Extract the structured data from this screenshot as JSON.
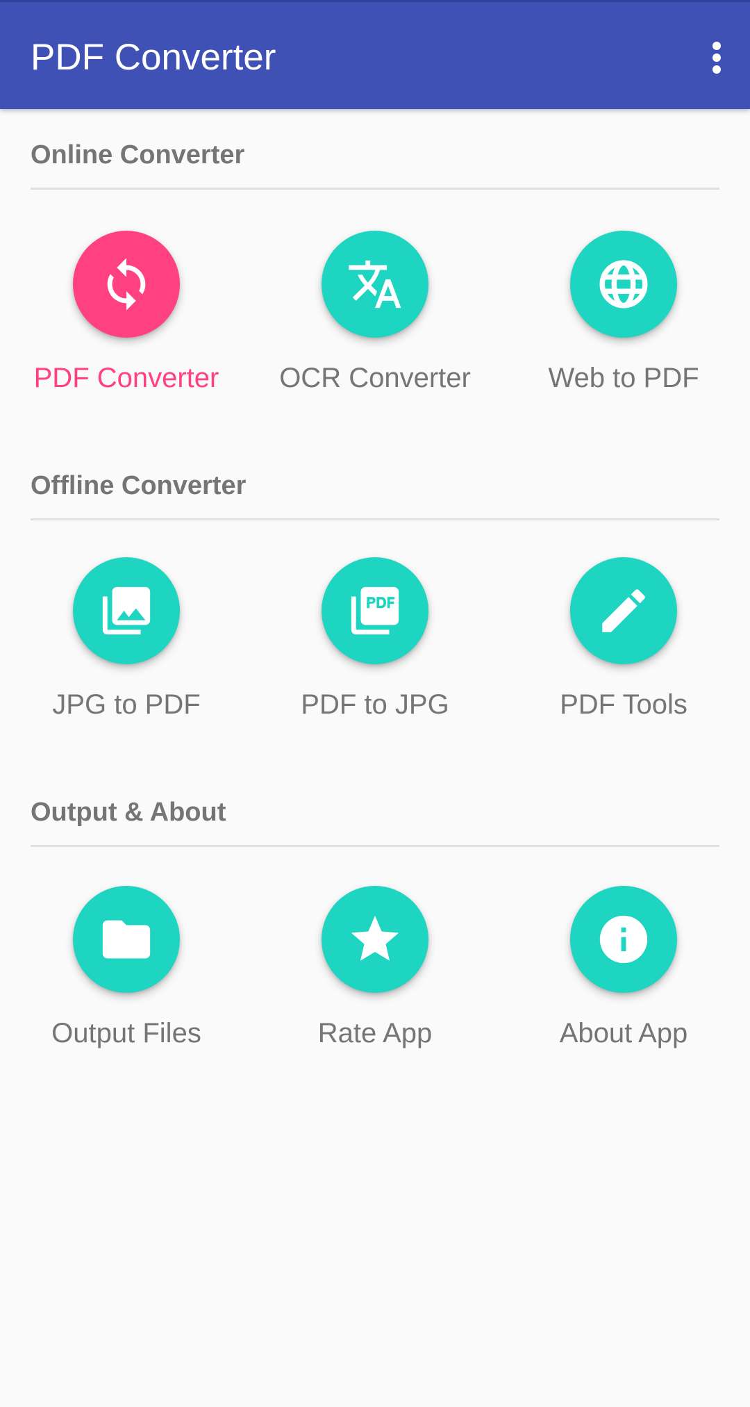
{
  "app_bar": {
    "title": "PDF Converter",
    "overflow_icon": "more-vert-icon"
  },
  "colors": {
    "primary": "#3f51b5",
    "accent_pink": "#ff4081",
    "fab_teal": "#1dd5c1",
    "label_gray": "#757575",
    "background": "#fafafa"
  },
  "sections": [
    {
      "title": "Online Converter",
      "items": [
        {
          "label": "PDF Converter",
          "icon": "sync-icon",
          "selected": true
        },
        {
          "label": "OCR Converter",
          "icon": "translate-icon",
          "selected": false
        },
        {
          "label": "Web to PDF",
          "icon": "globe-icon",
          "selected": false
        }
      ]
    },
    {
      "title": "Offline Converter",
      "items": [
        {
          "label": "JPG to PDF",
          "icon": "photo-library-icon",
          "selected": false
        },
        {
          "label": "PDF to JPG",
          "icon": "pdf-icon",
          "selected": false
        },
        {
          "label": "PDF Tools",
          "icon": "pencil-icon",
          "selected": false
        }
      ]
    },
    {
      "title": "Output & About",
      "items": [
        {
          "label": "Output Files",
          "icon": "folder-icon",
          "selected": false
        },
        {
          "label": "Rate App",
          "icon": "star-icon",
          "selected": false
        },
        {
          "label": "About App",
          "icon": "info-icon",
          "selected": false
        }
      ]
    }
  ]
}
